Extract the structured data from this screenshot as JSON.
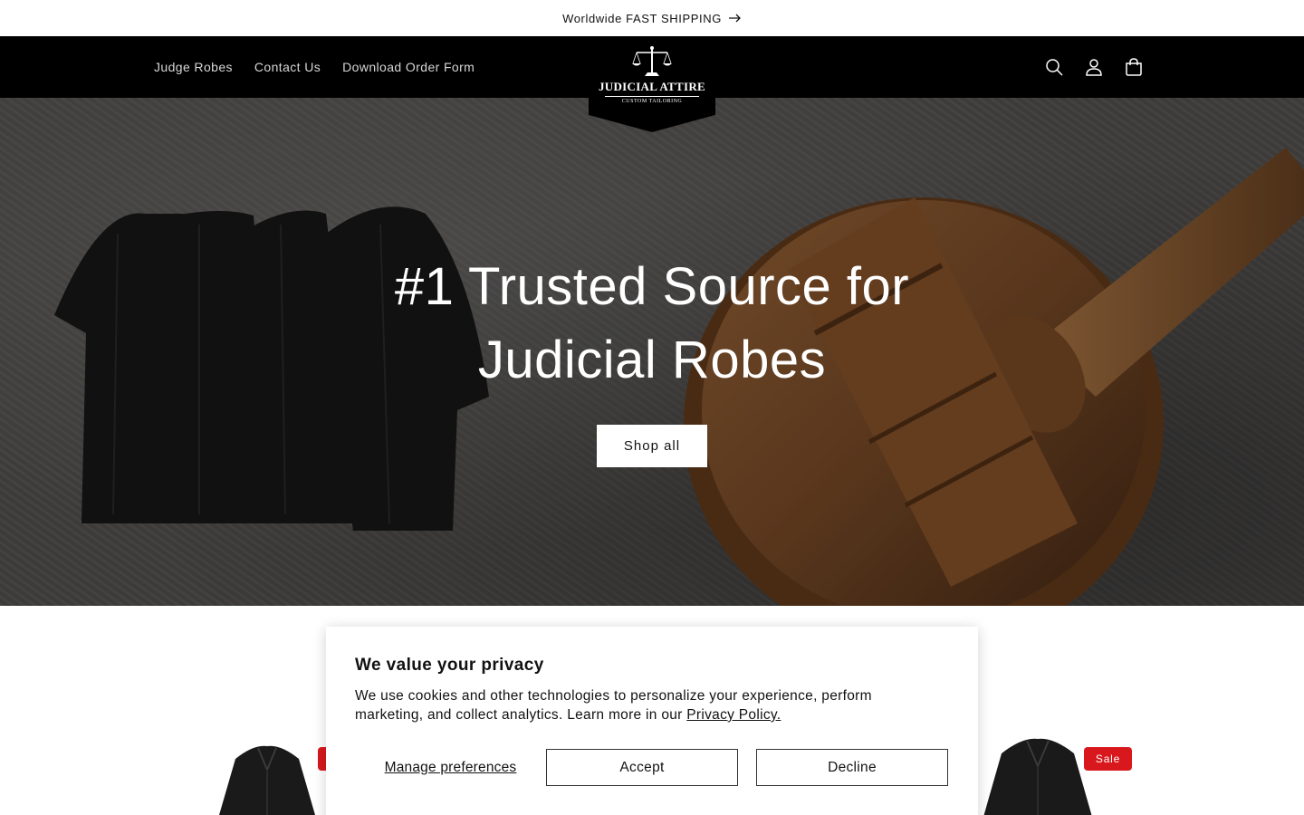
{
  "announcement": {
    "text": "Worldwide FAST SHIPPING",
    "arrow_icon": "arrow-right-icon"
  },
  "header": {
    "nav": [
      {
        "label": "Judge Robes"
      },
      {
        "label": "Contact Us"
      },
      {
        "label": "Download Order Form"
      }
    ],
    "logo": {
      "main": "JUDICIAL ATTIRE",
      "sub": "CUSTOM TAILORING",
      "icon": "scales-of-justice-icon"
    },
    "icons": [
      "search-icon",
      "account-icon",
      "cart-icon"
    ]
  },
  "hero": {
    "title_line1": "#1 Trusted Source for",
    "title_line2": "Judicial Robes",
    "button": "Shop all"
  },
  "products": {
    "sale_badge": "Sale"
  },
  "cookie_banner": {
    "title": "We value your privacy",
    "body": "We use cookies and other technologies to personalize your experience, perform marketing, and collect analytics. Learn more in our ",
    "link": "Privacy Policy.",
    "manage": "Manage preferences",
    "accept": "Accept",
    "decline": "Decline"
  },
  "colors": {
    "header_bg": "#000000",
    "sale_red": "#d8181d",
    "hero_bg": "#4d4b49"
  }
}
